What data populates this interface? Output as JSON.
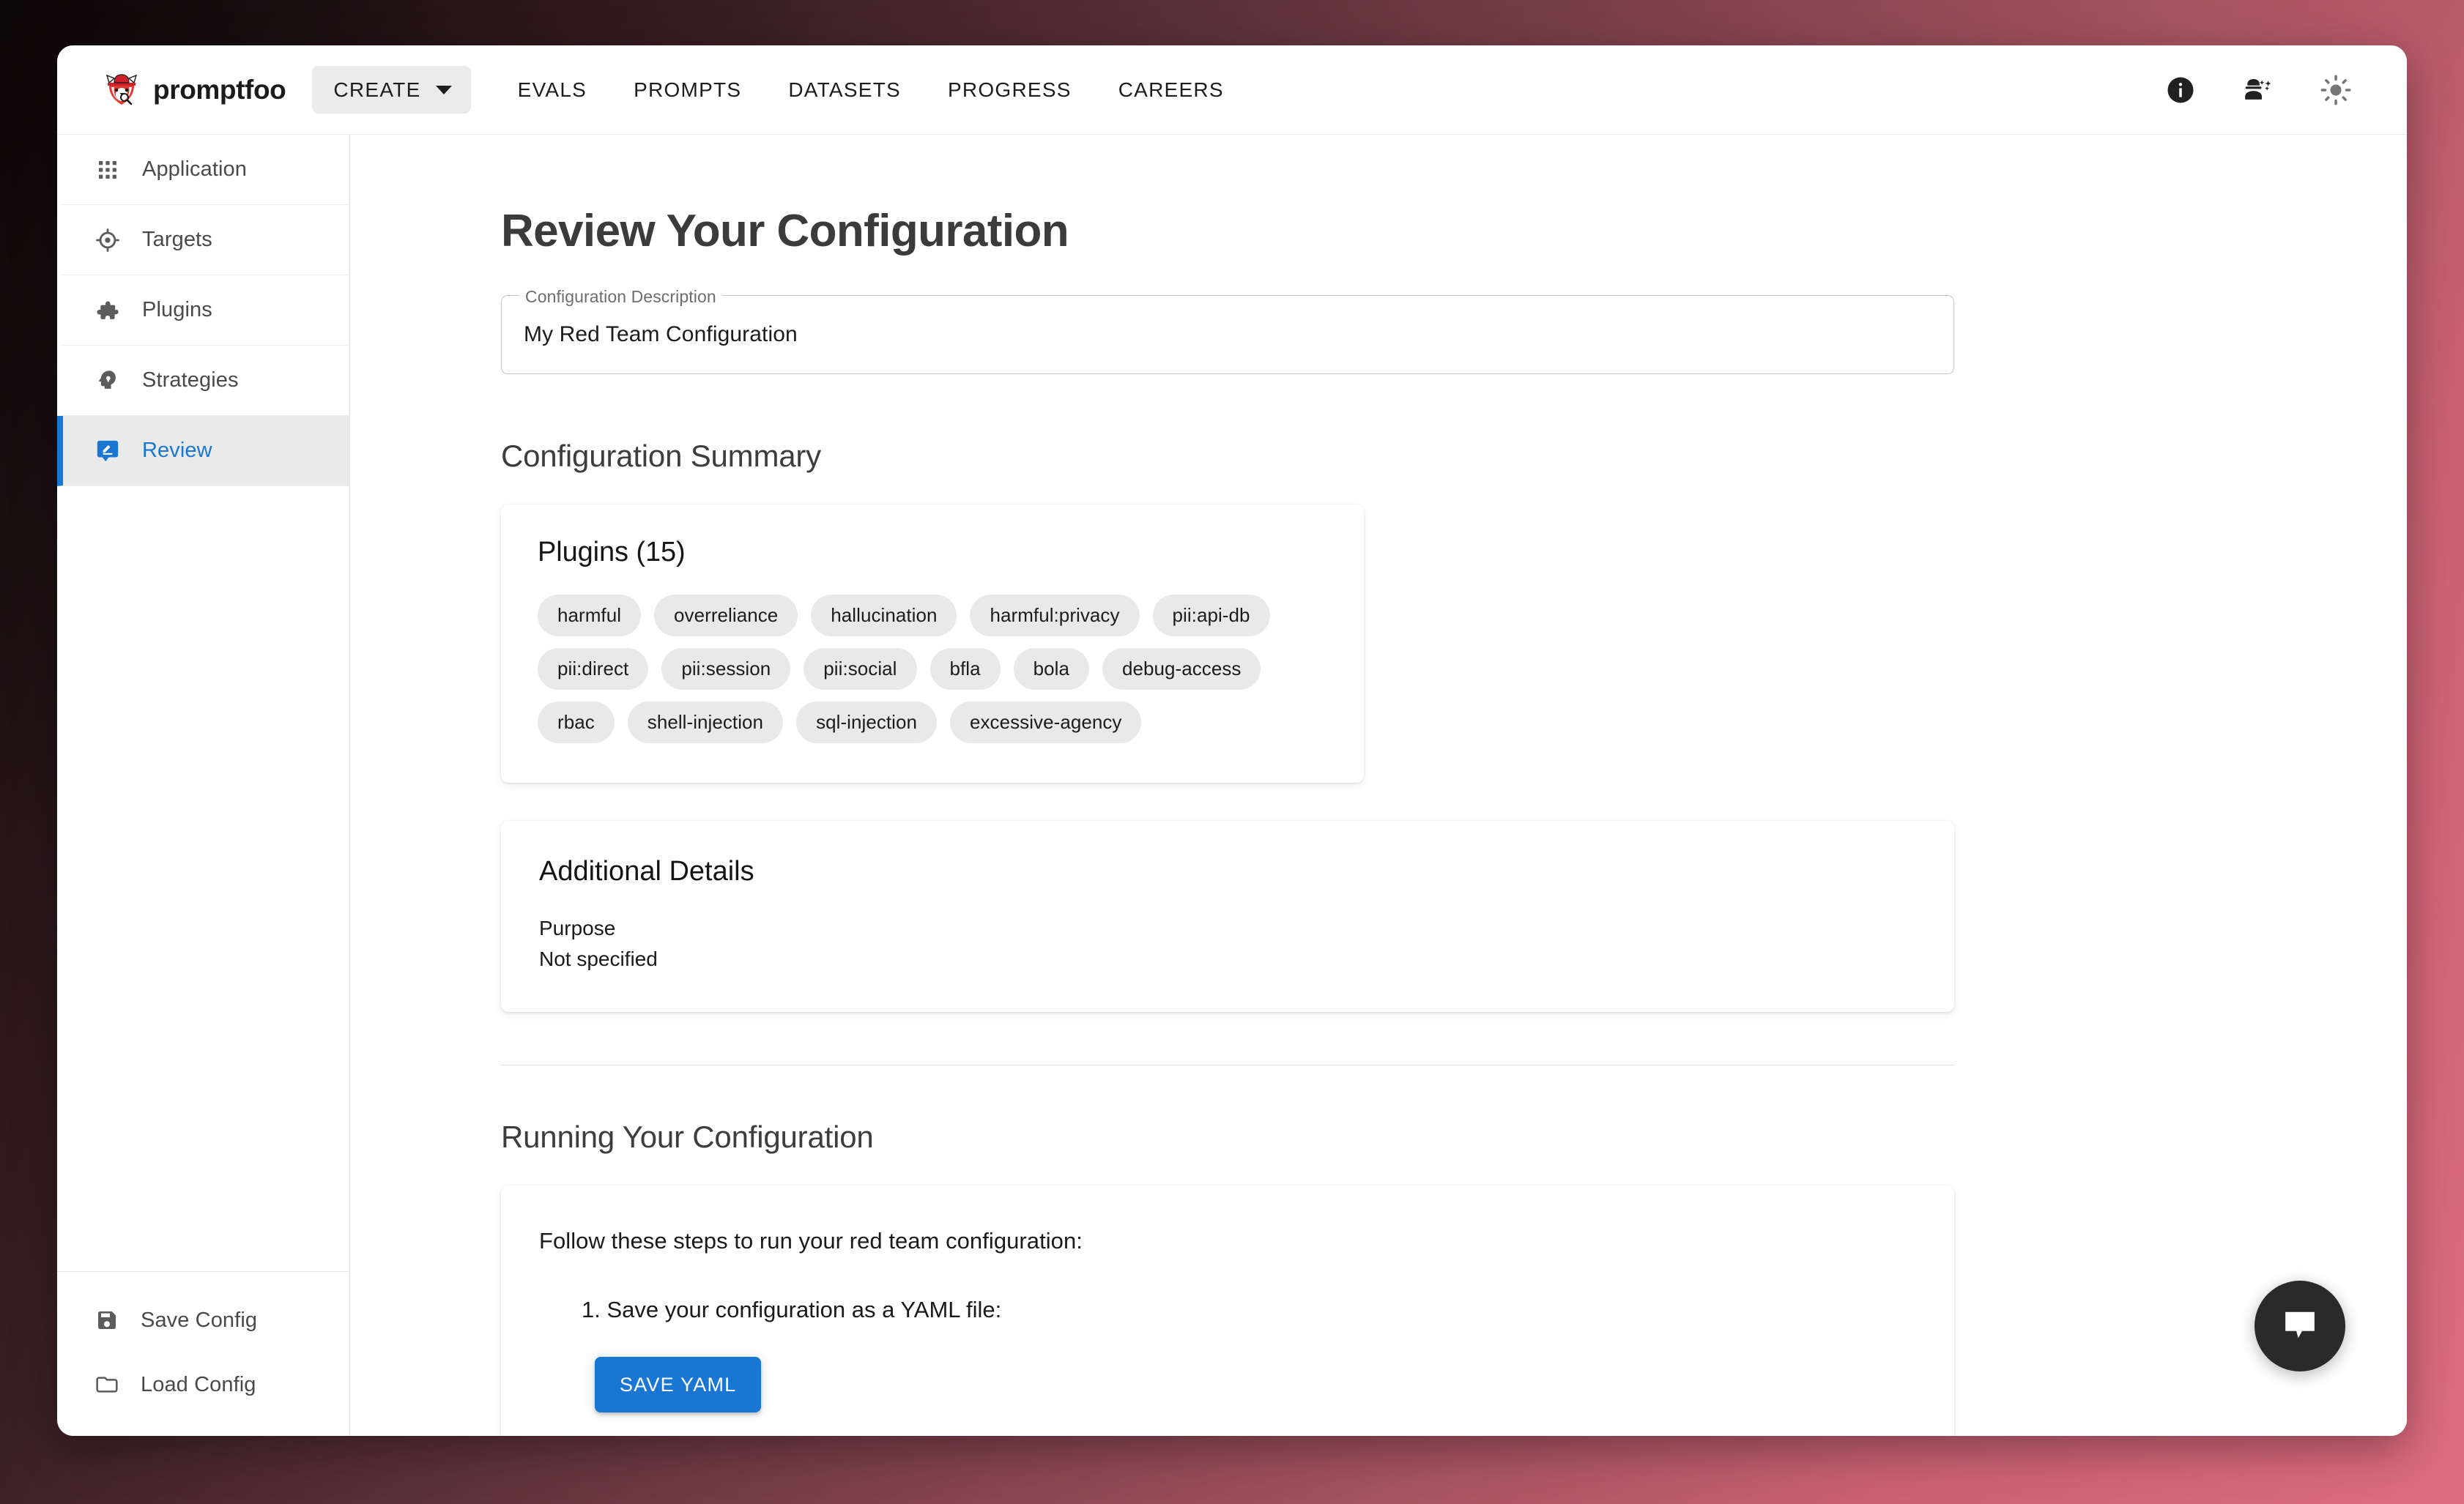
{
  "brand": {
    "name": "promptfoo",
    "logo_icon": "red-panda-detective-logo"
  },
  "topnav": {
    "create_label": "CREATE",
    "create_caret_icon": "chevron-down-icon",
    "links": [
      {
        "label": "EVALS"
      },
      {
        "label": "PROMPTS"
      },
      {
        "label": "DATASETS"
      },
      {
        "label": "PROGRESS"
      },
      {
        "label": "CAREERS"
      }
    ],
    "actions": [
      {
        "icon": "info-icon"
      },
      {
        "icon": "engineering-icon"
      },
      {
        "icon": "sun-icon"
      }
    ]
  },
  "sidebar": {
    "items": [
      {
        "label": "Application",
        "icon": "apps-grid-icon",
        "active": false
      },
      {
        "label": "Targets",
        "icon": "target-crosshair-icon",
        "active": false
      },
      {
        "label": "Plugins",
        "icon": "puzzle-piece-icon",
        "active": false
      },
      {
        "label": "Strategies",
        "icon": "psychology-head-icon",
        "active": false
      },
      {
        "label": "Review",
        "icon": "rate-review-icon",
        "active": true
      }
    ],
    "actions": [
      {
        "label": "Save Config",
        "icon": "floppy-disk-icon"
      },
      {
        "label": "Load Config",
        "icon": "folder-icon"
      }
    ]
  },
  "main": {
    "page_title": "Review Your Configuration",
    "description_field": {
      "label": "Configuration Description",
      "value": "My Red Team Configuration",
      "placeholder": "My Red Team Configuration"
    },
    "summary_heading": "Configuration Summary",
    "plugins_card": {
      "title": "Plugins (15)",
      "count": 15,
      "chips": [
        "harmful",
        "overreliance",
        "hallucination",
        "harmful:privacy",
        "pii:api-db",
        "pii:direct",
        "pii:session",
        "pii:social",
        "bfla",
        "bola",
        "debug-access",
        "rbac",
        "shell-injection",
        "sql-injection",
        "excessive-agency"
      ]
    },
    "details_card": {
      "title": "Additional Details",
      "purpose_label": "Purpose",
      "purpose_value": "Not specified"
    },
    "running_heading": "Running Your Configuration",
    "running_card": {
      "intro": "Follow these steps to run your red team configuration:",
      "step_1": "1. Save your configuration as a YAML file:",
      "save_yaml_label": "SAVE YAML"
    }
  },
  "chat_widget": {
    "icon": "chat-bubble-icon"
  },
  "colors": {
    "accent_blue": "#1976d2",
    "chip_grey": "#e9e9e9",
    "active_item_bg": "#eaeaea",
    "page_bg_gradient_dark": "#0a0506",
    "page_bg_gradient_light": "#dd6c80",
    "chat_fab_bg": "#2a2a2a"
  }
}
